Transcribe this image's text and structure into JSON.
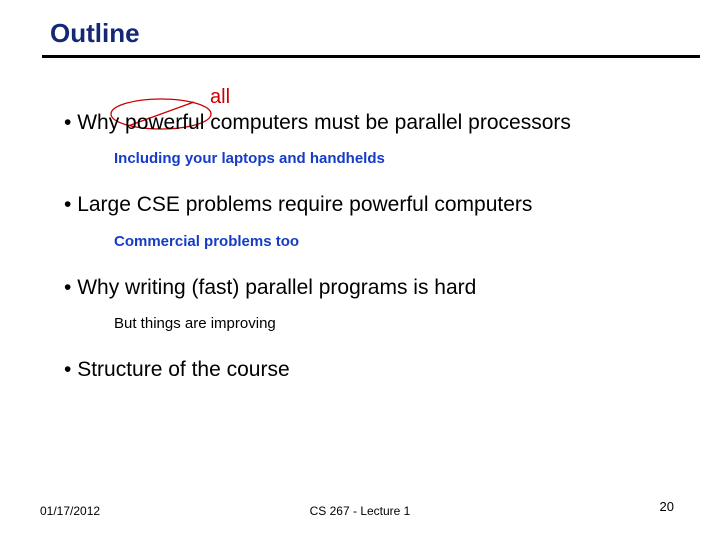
{
  "title": "Outline",
  "annotation": {
    "text": "all"
  },
  "bullets": [
    {
      "text": "Why powerful computers must be parallel processors",
      "sub": "Including your laptops and handhelds"
    },
    {
      "text": "Large CSE problems require powerful computers",
      "sub": "Commercial problems too"
    },
    {
      "text": "Why writing (fast) parallel programs is hard",
      "sub": "But things are improving"
    },
    {
      "text": "Structure of the course"
    }
  ],
  "footer": {
    "date": "01/17/2012",
    "course": "CS 267 - Lecture 1",
    "page": "20"
  }
}
